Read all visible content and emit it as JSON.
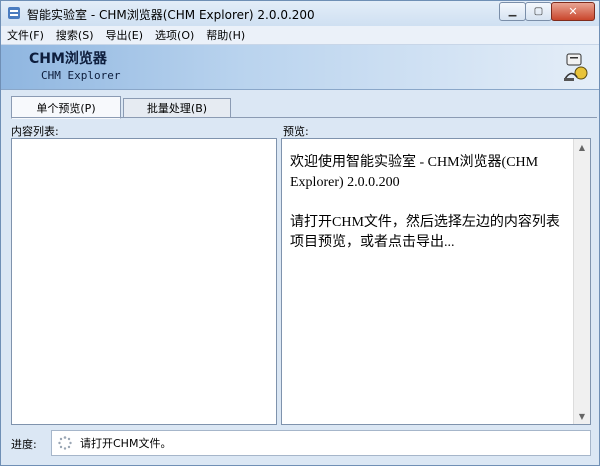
{
  "window": {
    "title": "智能实验室 - CHM浏览器(CHM Explorer) 2.0.0.200"
  },
  "menu": [
    {
      "label": "文件(F)"
    },
    {
      "label": "搜索(S)"
    },
    {
      "label": "导出(E)"
    },
    {
      "label": "选项(O)"
    },
    {
      "label": "帮助(H)"
    }
  ],
  "banner": {
    "title": "CHM浏览器",
    "subtitle": "CHM Explorer"
  },
  "tabs": [
    {
      "label": "单个预览(P)",
      "active": true
    },
    {
      "label": "批量处理(B)",
      "active": false
    }
  ],
  "content_list": {
    "label": "内容列表:",
    "items": []
  },
  "preview": {
    "label": "预览:",
    "paragraphs": [
      "欢迎使用智能实验室 - CHM浏览器(CHM Explorer) 2.0.0.200",
      "请打开CHM文件，然后选择左边的内容列表项目预览，或者点击导出..."
    ]
  },
  "status": {
    "label": "进度:",
    "text": "请打开CHM文件。"
  },
  "colors": {
    "accent": "#8fb6e0",
    "close_button": "#c9462c"
  }
}
